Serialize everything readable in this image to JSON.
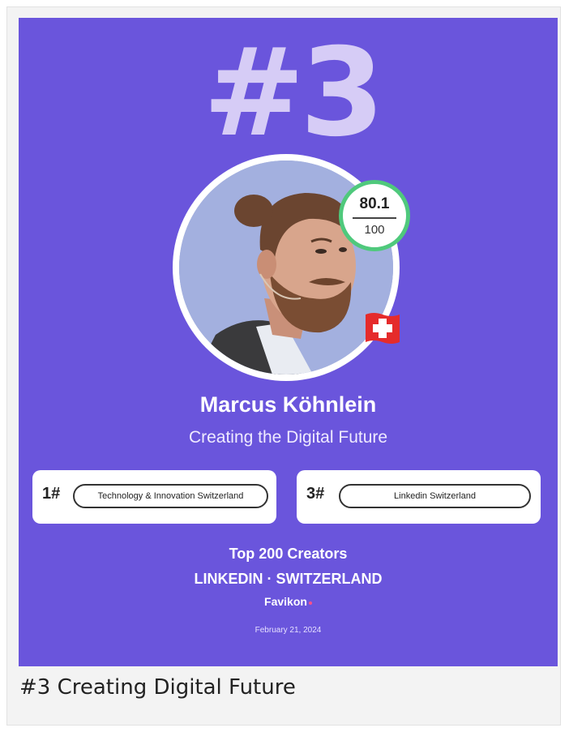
{
  "card": {
    "rank_big": "#3",
    "score": {
      "value": "80.1",
      "max": "100"
    },
    "person": {
      "name": "Marcus Köhnlein",
      "tagline": "Creating the Digital Future"
    },
    "flag_icon": "switzerland-flag-icon",
    "rankings": [
      {
        "position": "1#",
        "category": "Technology & Innovation Switzerland"
      },
      {
        "position": "3#",
        "category": "Linkedin Switzerland"
      }
    ],
    "footer": {
      "title": "Top 200 Creators",
      "subtitle": "LINKEDIN · SWITZERLAND",
      "brand": "Favikon",
      "date": "February 21, 2024"
    }
  },
  "caption": "#3 Creating Digital Future",
  "colors": {
    "card_bg": "#6a55dc",
    "rank_big": "#d6ccf6",
    "score_ring": "#4fc97c",
    "flag_red": "#e52b2b",
    "brand_dot": "#ff4f8b"
  }
}
